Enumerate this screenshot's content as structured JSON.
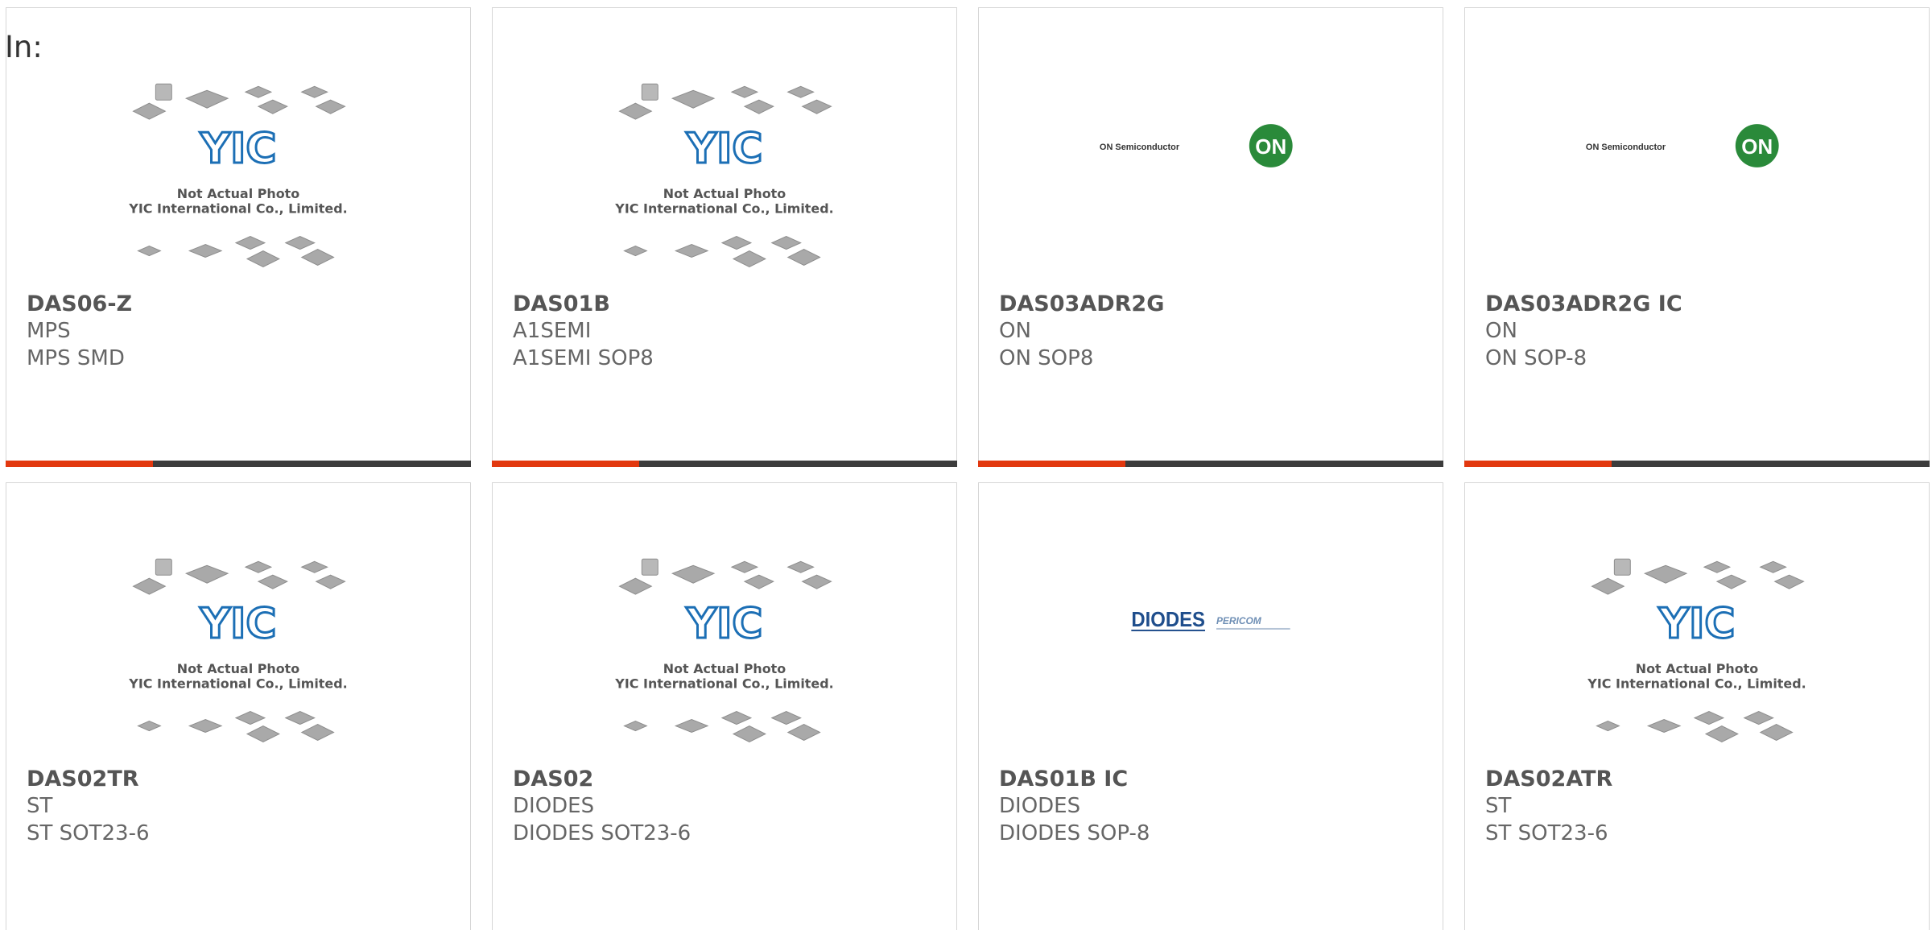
{
  "page": {
    "in_label": "In:"
  },
  "placeholder": {
    "line1": "Not Actual Photo",
    "line2": "YIC International Co., Limited.",
    "yic_logo": "YIC"
  },
  "logos": {
    "on_semi_text": "ON Semiconductor",
    "on_mark": "ON",
    "diodes_text": "DIODES",
    "pericom_text": "PERICOM"
  },
  "colors": {
    "accent": "#e2380f",
    "dark_bar": "#3c3c3c",
    "yic_blue": "#1c6fb5",
    "on_green": "#2a8a3a",
    "diodes_blue": "#1f4e8c"
  },
  "products": [
    {
      "part": "DAS06-Z",
      "brand": "MPS",
      "package": "MPS SMD",
      "image": "yic-placeholder"
    },
    {
      "part": "DAS01B",
      "brand": "A1SEMI",
      "package": "A1SEMI SOP8",
      "image": "yic-placeholder"
    },
    {
      "part": "DAS03ADR2G",
      "brand": "ON",
      "package": "ON SOP8",
      "image": "on-semiconductor-logo"
    },
    {
      "part": "DAS03ADR2G IC",
      "brand": "ON",
      "package": "ON SOP-8",
      "image": "on-semiconductor-logo"
    },
    {
      "part": "DAS02TR",
      "brand": "ST",
      "package": "ST SOT23-6",
      "image": "yic-placeholder"
    },
    {
      "part": "DAS02",
      "brand": "DIODES",
      "package": "DIODES SOT23-6",
      "image": "yic-placeholder"
    },
    {
      "part": "DAS01B IC",
      "brand": "DIODES",
      "package": "DIODES SOP-8",
      "image": "diodes-logo"
    },
    {
      "part": "DAS02ATR",
      "brand": "ST",
      "package": "ST SOT23-6",
      "image": "yic-placeholder"
    }
  ]
}
